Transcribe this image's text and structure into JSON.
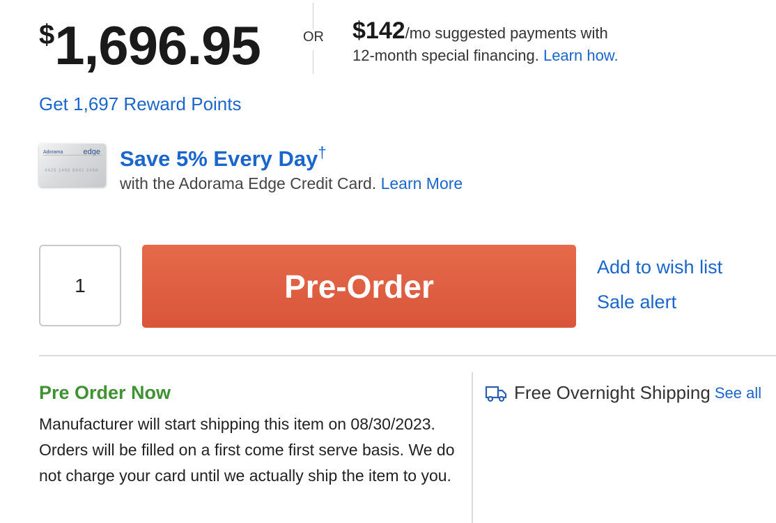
{
  "price": {
    "currency": "$",
    "amount": "1,696.95"
  },
  "or_label": "OR",
  "financing": {
    "monthly": "$142",
    "line1_rest": "/mo suggested payments with",
    "line2": "12-month special financing.",
    "learn_link": "Learn how."
  },
  "reward_link": "Get 1,697 Reward Points",
  "credit_card": {
    "card_brand": "Adorama",
    "card_edge": "edge",
    "card_number": "4425 2468 8642 2468",
    "title": "Save 5% Every Day",
    "dagger": "†",
    "subtitle": "with the Adorama Edge Credit Card.",
    "learn_more": "Learn More"
  },
  "purchase": {
    "quantity": "1",
    "button_label": "Pre-Order",
    "wish_list": "Add to wish list",
    "sale_alert": "Sale alert"
  },
  "preorder_info": {
    "title": "Pre Order Now",
    "body": "Manufacturer will start shipping this item on 08/30/2023. Orders will be filled on a first come first serve basis. We do not charge your card until we actually ship the item to you."
  },
  "shipping": {
    "icon": "truck-icon",
    "label": "Free Overnight Shipping",
    "see_all": "See all"
  },
  "colors": {
    "link": "#1a66cc",
    "button": "#df5f43",
    "preorder_title": "#3f9232"
  }
}
